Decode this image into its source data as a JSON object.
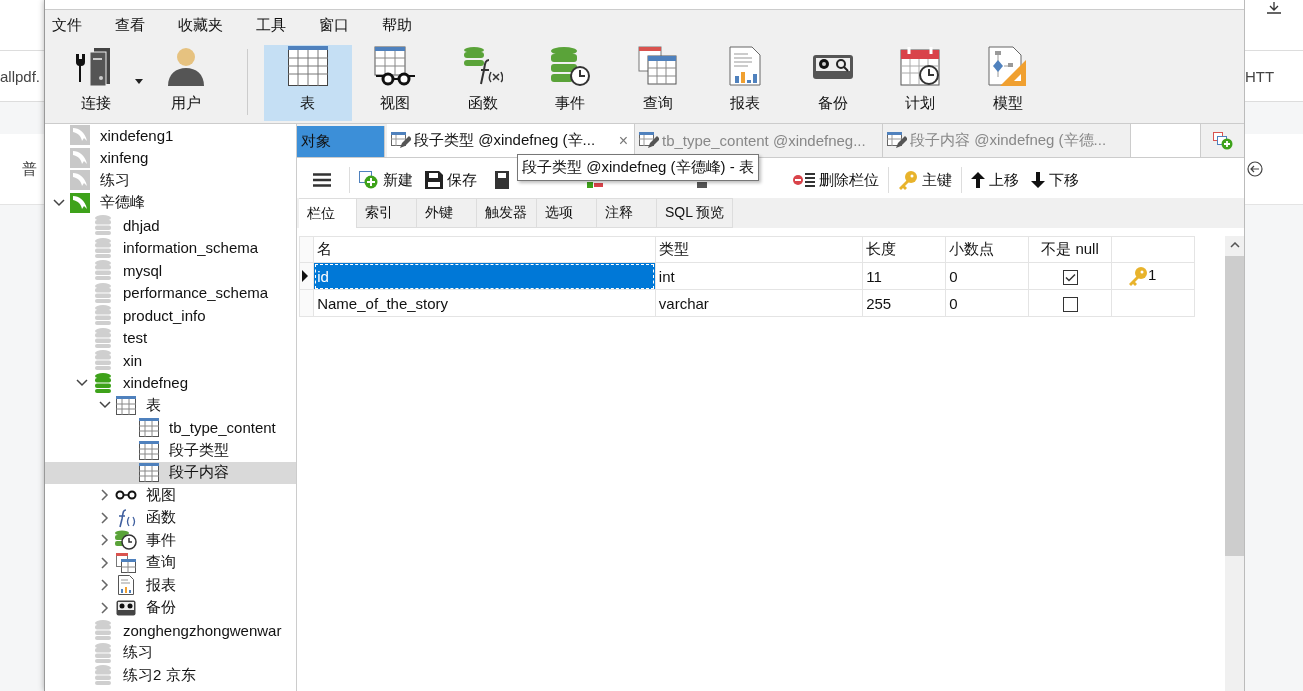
{
  "backdrop": {
    "left_texts": [
      "allpdf.",
      "普"
    ],
    "right_texts": [
      "HTT"
    ]
  },
  "menu": [
    "文件",
    "查看",
    "收藏夹",
    "工具",
    "窗口",
    "帮助"
  ],
  "ribbon": [
    {
      "items": [
        {
          "label": "连接",
          "kind": "connection",
          "selected": false,
          "has_menu": true
        },
        {
          "label": "用户",
          "kind": "user",
          "selected": false,
          "has_menu": false
        }
      ]
    },
    {
      "items": [
        {
          "label": "表",
          "kind": "table",
          "selected": true,
          "has_menu": false
        },
        {
          "label": "视图",
          "kind": "view",
          "selected": false,
          "has_menu": false
        },
        {
          "label": "函数",
          "kind": "function",
          "selected": false,
          "has_menu": false
        },
        {
          "label": "事件",
          "kind": "event",
          "selected": false,
          "has_menu": false
        },
        {
          "label": "查询",
          "kind": "query",
          "selected": false,
          "has_menu": false
        },
        {
          "label": "报表",
          "kind": "report",
          "selected": false,
          "has_menu": false
        },
        {
          "label": "备份",
          "kind": "backup",
          "selected": false,
          "has_menu": false
        },
        {
          "label": "计划",
          "kind": "schedule",
          "selected": false,
          "has_menu": false
        },
        {
          "label": "模型",
          "kind": "model",
          "selected": false,
          "has_menu": false
        }
      ]
    }
  ],
  "tree": [
    {
      "label": "xindefeng1",
      "kind": "connection",
      "open": false,
      "expanded": false,
      "selected": false
    },
    {
      "label": "xinfeng",
      "kind": "connection",
      "open": false,
      "expanded": false,
      "selected": false
    },
    {
      "label": "练习",
      "kind": "connection",
      "open": false,
      "expanded": false,
      "selected": false
    },
    {
      "label": "辛德峰",
      "kind": "connection",
      "open": true,
      "expanded": true,
      "selected": false,
      "children": [
        {
          "label": "dhjad",
          "kind": "database",
          "open": false,
          "expanded": false,
          "selected": false
        },
        {
          "label": "information_schema",
          "kind": "database",
          "open": false,
          "expanded": false,
          "selected": false
        },
        {
          "label": "mysql",
          "kind": "database",
          "open": false,
          "expanded": false,
          "selected": false
        },
        {
          "label": "performance_schema",
          "kind": "database",
          "open": false,
          "expanded": false,
          "selected": false
        },
        {
          "label": "product_info",
          "kind": "database",
          "open": false,
          "expanded": false,
          "selected": false
        },
        {
          "label": "test",
          "kind": "database",
          "open": false,
          "expanded": false,
          "selected": false
        },
        {
          "label": "xin",
          "kind": "database",
          "open": false,
          "expanded": false,
          "selected": false
        },
        {
          "label": "xindefneg",
          "kind": "database",
          "open": true,
          "expanded": true,
          "selected": false,
          "children": [
            {
              "label": "表",
              "kind": "tables",
              "expanded": true,
              "selected": false,
              "children": [
                {
                  "label": "tb_type_content",
                  "kind": "table",
                  "expanded": false,
                  "selected": false
                },
                {
                  "label": "段子类型",
                  "kind": "table",
                  "expanded": false,
                  "selected": false
                },
                {
                  "label": "段子内容",
                  "kind": "table",
                  "expanded": false,
                  "selected": true
                }
              ]
            },
            {
              "label": "视图",
              "kind": "views",
              "expanded": false,
              "selected": false
            },
            {
              "label": "函数",
              "kind": "functions",
              "expanded": false,
              "selected": false
            },
            {
              "label": "事件",
              "kind": "events",
              "expanded": false,
              "selected": false
            },
            {
              "label": "查询",
              "kind": "queries",
              "expanded": false,
              "selected": false
            },
            {
              "label": "报表",
              "kind": "reports",
              "expanded": false,
              "selected": false
            },
            {
              "label": "备份",
              "kind": "backups",
              "expanded": false,
              "selected": false
            }
          ]
        },
        {
          "label": "zonghengzhongwenwar",
          "kind": "database",
          "open": false,
          "expanded": false,
          "selected": false
        },
        {
          "label": "练习",
          "kind": "database",
          "open": false,
          "expanded": false,
          "selected": false
        },
        {
          "label": "练习2  京东",
          "kind": "database",
          "open": false,
          "expanded": false,
          "selected": false
        }
      ]
    }
  ],
  "tabs": [
    {
      "label": "对象",
      "kind": "object",
      "selected": false
    },
    {
      "label": "段子类型 @xindefneg (辛...",
      "kind": "editor",
      "selected": true,
      "close": "×"
    },
    {
      "label": "tb_type_content @xindefneg...",
      "kind": "editor",
      "selected": false
    },
    {
      "label": "段子内容 @xindefneg (辛德...",
      "kind": "editor",
      "selected": false
    }
  ],
  "tooltip": "段子类型 @xindefneg (辛德峰) - 表",
  "toolbar": [
    {
      "label": "新建",
      "kind": "new"
    },
    {
      "label": "保存",
      "kind": "save"
    },
    {
      "kind": "save-as"
    },
    {
      "kind": "add-field"
    },
    {
      "kind": "insert-field"
    },
    {
      "label": "删除栏位",
      "kind": "delete-field"
    },
    {
      "label": "主键",
      "kind": "key"
    },
    {
      "label": "上移",
      "kind": "up"
    },
    {
      "label": "下移",
      "kind": "down"
    }
  ],
  "subtabs": [
    {
      "label": "栏位",
      "selected": true
    },
    {
      "label": "索引",
      "selected": false
    },
    {
      "label": "外键",
      "selected": false
    },
    {
      "label": "触发器",
      "selected": false
    },
    {
      "label": "选项",
      "selected": false
    },
    {
      "label": "注释",
      "selected": false
    },
    {
      "label": "SQL 预览",
      "selected": false
    }
  ],
  "grid": {
    "columns": [
      "名",
      "类型",
      "长度",
      "小数点",
      "不是 null"
    ],
    "rows": [
      {
        "name": "id",
        "type": "int",
        "length": "11",
        "decimals": "0",
        "not_null": true,
        "key": "1",
        "current": true,
        "selected": true
      },
      {
        "name": "Name_of_the_story",
        "type": "varchar",
        "length": "255",
        "decimals": "0",
        "not_null": false,
        "current": false,
        "selected": false
      }
    ]
  }
}
